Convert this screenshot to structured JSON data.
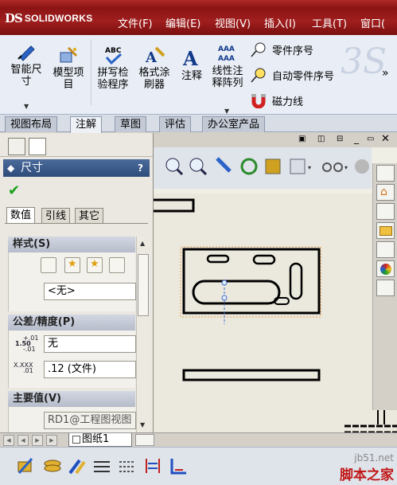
{
  "app": {
    "brand": "SOLIDWORKS",
    "brand_mark": "DS"
  },
  "menu": [
    "文件(F)",
    "编辑(E)",
    "视图(V)",
    "插入(I)",
    "工具(T)",
    "窗口("
  ],
  "ribbon": {
    "smart_dimension": [
      "智能尺",
      "寸"
    ],
    "model_items": [
      "模型项",
      "目"
    ],
    "spell_check": [
      "拼写检",
      "验程序"
    ],
    "format_painter": [
      "格式涂",
      "刷器"
    ],
    "note": "注释",
    "linear_note": [
      "线性注",
      "释阵列"
    ],
    "balloon": "零件序号",
    "auto_balloon": "自动零件序号",
    "magnetic_line": "磁力线",
    "abc": "ABC",
    "aaa": "AAA",
    "overflow": "»"
  },
  "command_tabs": [
    "视图布局",
    "注解",
    "草图",
    "评估",
    "办公室产品"
  ],
  "active_command_tab": 1,
  "property_manager": {
    "title": "尺寸",
    "help": "?",
    "subtabs": [
      "数值",
      "引线",
      "其它"
    ],
    "style_section": "样式(S)",
    "style_value": "<无>",
    "tolerance_section": "公差/精度(P)",
    "tolerance_type": "无",
    "tolerance_sym": [
      "+.01",
      "1.50",
      "-.01"
    ],
    "precision_value": ".12 (文件)",
    "precision_sym": [
      "X.XXX",
      ".01"
    ],
    "primary_section": "主要值(V)",
    "primary_value": "RD1@工程图视图"
  },
  "sheet_tab": "图纸1",
  "watermark": {
    "url": "jb51.net",
    "name": "脚本之家"
  },
  "colors": {
    "menubar": "#9a1b1b",
    "pm_title": "#3a5a8a",
    "check": "#18a018",
    "watermark": "#c01818"
  }
}
